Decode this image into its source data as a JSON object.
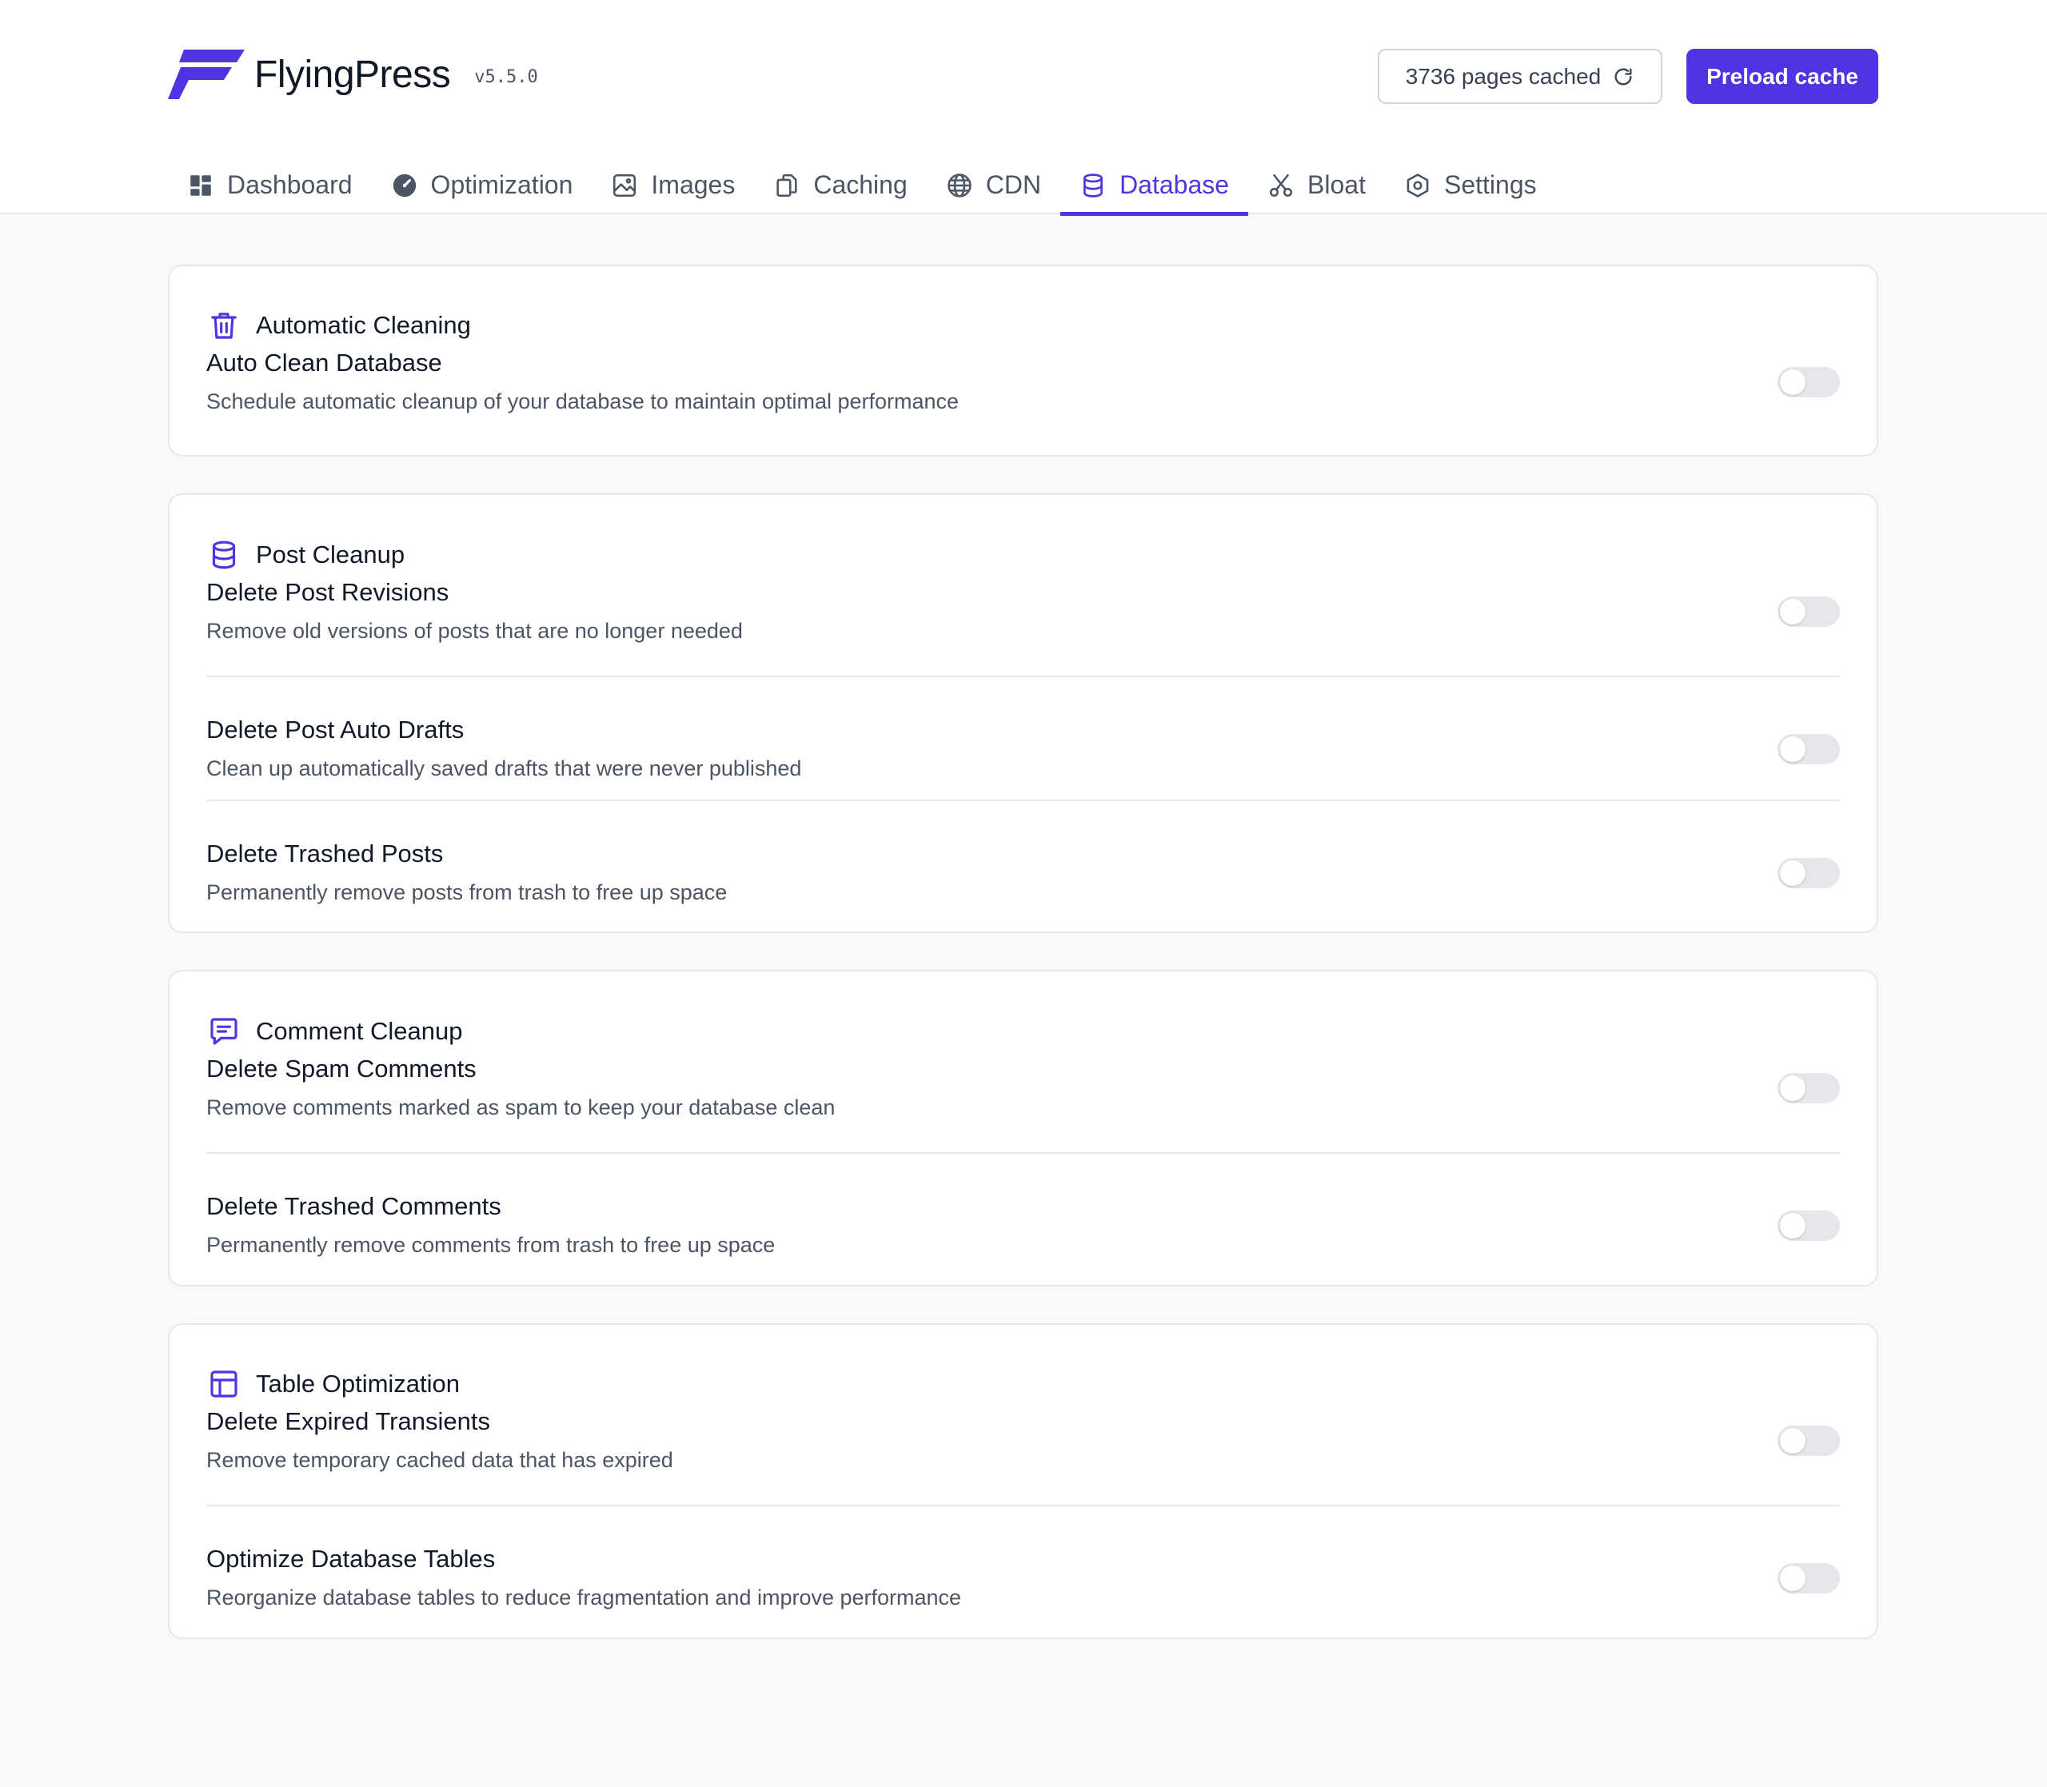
{
  "brand": {
    "name": "FlyingPress",
    "version": "v5.5.0",
    "accent": "#4f35e1"
  },
  "header": {
    "cached_label": "3736 pages cached",
    "preload_label": "Preload cache"
  },
  "nav": {
    "items": [
      {
        "label": "Dashboard",
        "icon": "dashboard-icon"
      },
      {
        "label": "Optimization",
        "icon": "gauge-icon"
      },
      {
        "label": "Images",
        "icon": "image-icon"
      },
      {
        "label": "Caching",
        "icon": "copy-icon"
      },
      {
        "label": "CDN",
        "icon": "globe-icon"
      },
      {
        "label": "Database",
        "icon": "database-icon",
        "active": true
      },
      {
        "label": "Bloat",
        "icon": "scissors-icon"
      },
      {
        "label": "Settings",
        "icon": "settings-icon"
      }
    ]
  },
  "sections": [
    {
      "title": "Automatic Cleaning",
      "icon": "trash-icon",
      "rows": [
        {
          "title": "Auto Clean Database",
          "desc": "Schedule automatic cleanup of your database to maintain optimal performance",
          "enabled": false
        }
      ]
    },
    {
      "title": "Post Cleanup",
      "icon": "database-icon",
      "rows": [
        {
          "title": "Delete Post Revisions",
          "desc": "Remove old versions of posts that are no longer needed",
          "enabled": false
        },
        {
          "title": "Delete Post Auto Drafts",
          "desc": "Clean up automatically saved drafts that were never published",
          "enabled": false
        },
        {
          "title": "Delete Trashed Posts",
          "desc": "Permanently remove posts from trash to free up space",
          "enabled": false
        }
      ]
    },
    {
      "title": "Comment Cleanup",
      "icon": "comment-icon",
      "rows": [
        {
          "title": "Delete Spam Comments",
          "desc": "Remove comments marked as spam to keep your database clean",
          "enabled": false
        },
        {
          "title": "Delete Trashed Comments",
          "desc": "Permanently remove comments from trash to free up space",
          "enabled": false
        }
      ]
    },
    {
      "title": "Table Optimization",
      "icon": "table-icon",
      "rows": [
        {
          "title": "Delete Expired Transients",
          "desc": "Remove temporary cached data that has expired",
          "enabled": false
        },
        {
          "title": "Optimize Database Tables",
          "desc": "Reorganize database tables to reduce fragmentation and improve performance",
          "enabled": false
        }
      ]
    }
  ]
}
